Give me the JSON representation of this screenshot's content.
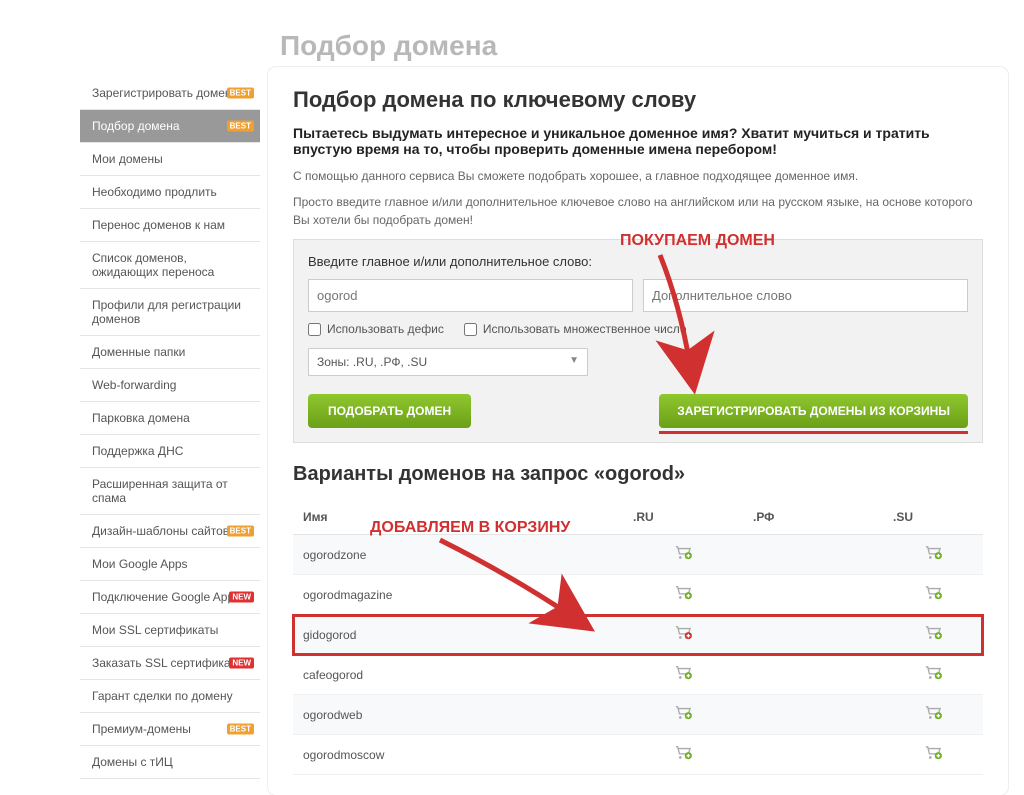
{
  "page_title": "Подбор домена",
  "sidebar": {
    "items": [
      {
        "label": "Зарегистрировать домен",
        "badge": "BEST"
      },
      {
        "label": "Подбор домена",
        "badge": "BEST",
        "active": true
      },
      {
        "label": "Мои домены"
      },
      {
        "label": "Необходимо продлить"
      },
      {
        "label": "Перенос доменов к нам"
      },
      {
        "label": "Список доменов, ожидающих переноса"
      },
      {
        "label": "Профили для регистрации доменов"
      },
      {
        "label": "Доменные папки"
      },
      {
        "label": "Web-forwarding"
      },
      {
        "label": "Парковка домена"
      },
      {
        "label": "Поддержка ДНС"
      },
      {
        "label": "Расширенная защита от спама"
      },
      {
        "label": "Дизайн-шаблоны сайтов",
        "badge": "BEST"
      },
      {
        "label": "Мои Google Apps"
      },
      {
        "label": "Подключение Google Apps",
        "badge": "NEW"
      },
      {
        "label": "Мои SSL сертификаты"
      },
      {
        "label": "Заказать SSL сертификат",
        "badge": "NEW"
      },
      {
        "label": "Гарант сделки по домену"
      },
      {
        "label": "Премиум-домены",
        "badge": "BEST"
      },
      {
        "label": "Домены с тИЦ"
      }
    ]
  },
  "panel": {
    "heading": "Подбор домена по ключевому слову",
    "subheading": "Пытаетесь выдумать интересное и уникальное доменное имя? Хватит мучиться и тратить впустую время на то, чтобы проверить доменные имена перебором!",
    "desc1": "С помощью данного сервиса Вы сможете подобрать хорошее, а главное подходящее доменное имя.",
    "desc2": "Просто введите главное и/или дополнительное ключевое слово на английском или на русском языке, на основе которого Вы хотели бы подобрать домен!"
  },
  "form": {
    "label": "Введите главное и/или дополнительное слово:",
    "input1_value": "ogorod",
    "input2_placeholder": "Дополнительное слово",
    "checkbox1": "Использовать дефис",
    "checkbox2": "Использовать множественное число",
    "zones": "Зоны: .RU, .РФ, .SU",
    "btn_search": "ПОДОБРАТЬ ДОМЕН",
    "btn_register": "ЗАРЕГИСТРИРОВАТЬ ДОМЕНЫ ИЗ КОРЗИНЫ"
  },
  "results": {
    "title": "Варианты доменов на запрос «ogorod»",
    "headers": {
      "name": "Имя",
      "ru": ".RU",
      "rf": ".РФ",
      "su": ".SU"
    },
    "rows": [
      {
        "name": "ogorodzone",
        "ru": true,
        "su": true
      },
      {
        "name": "ogorodmagazine",
        "ru": true,
        "su": true
      },
      {
        "name": "gidogorod",
        "ru": true,
        "su": true,
        "highlight": true,
        "ru_red": true
      },
      {
        "name": "cafeogorod",
        "ru": true,
        "su": true
      },
      {
        "name": "ogorodweb",
        "ru": true,
        "su": true
      },
      {
        "name": "ogorodmoscow",
        "ru": true,
        "su": true
      }
    ]
  },
  "annotations": {
    "buy": "ПОКУПАЕМ ДОМЕН",
    "add": "ДОБАВЛЯЕМ В КОРЗИНУ"
  }
}
